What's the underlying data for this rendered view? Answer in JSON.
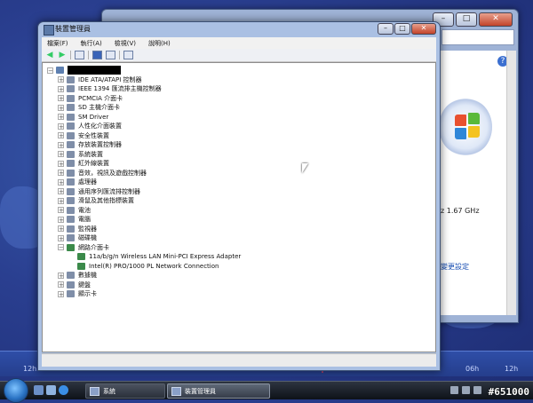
{
  "desktop": {
    "timeline_labels": [
      "12h",
      "06h",
      "12h"
    ]
  },
  "back_window": {
    "cpu_text": "z  1.67 GHz",
    "change_link": "變更設定"
  },
  "main_window": {
    "title": "裝置管理員",
    "menu": [
      "檔案(F)",
      "執行(A)",
      "檢視(V)",
      "說明(H)"
    ],
    "tree": {
      "root": "",
      "categories": [
        "IDE ATA/ATAPI 控制器",
        "IEEE 1394 匯流排主機控制器",
        "PCMCIA 介面卡",
        "SD 主機介面卡",
        "SM Driver",
        "人性化介面裝置",
        "安全性裝置",
        "存放裝置控制器",
        "系統裝置",
        "紅外線裝置",
        "音效，視訊及遊戲控制器",
        "處理器",
        "通用序列匯流排控制器",
        "滑鼠及其他指標裝置",
        "電池",
        "電腦",
        "監視器",
        "磁碟機"
      ],
      "expanded_category": "網路介面卡",
      "expanded_children": [
        "11a/b/g/n Wireless LAN Mini-PCI Express Adapter",
        "Intel(R) PRO/1000 PL Network Connection"
      ],
      "categories_after": [
        "數據機",
        "鍵盤",
        "顯示卡"
      ]
    }
  },
  "taskbar": {
    "tasks": [
      {
        "label": "系統",
        "active": false
      },
      {
        "label": "裝置管理員",
        "active": true
      }
    ],
    "watermark": "#651000"
  }
}
